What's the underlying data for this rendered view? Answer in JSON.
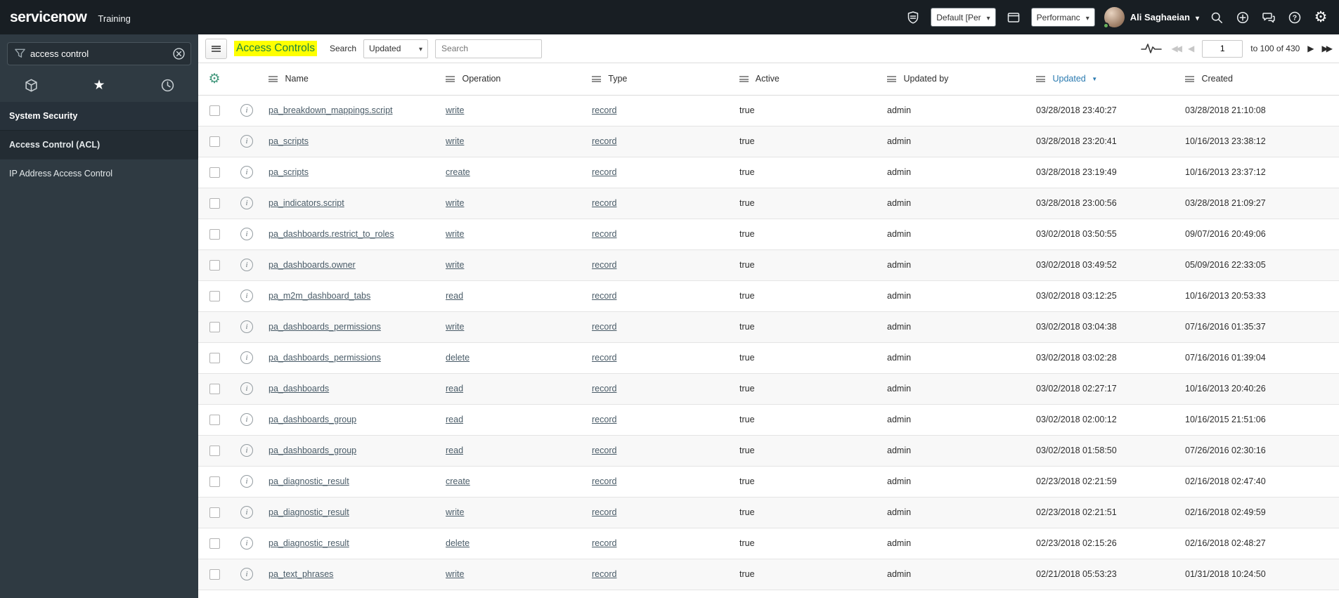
{
  "banner": {
    "logo": "servicenow",
    "instance": "Training",
    "update_set": "Default [Per",
    "application": "Performanc",
    "user": "Ali Saghaeian"
  },
  "sidebar": {
    "filter_value": "access control",
    "section": "System Security",
    "items": [
      {
        "label": "Access Control (ACL)",
        "selected": true
      },
      {
        "label": "IP Address Access Control",
        "selected": false
      }
    ]
  },
  "list": {
    "title": "Access Controls",
    "search_label": "Search",
    "search_field": "Updated",
    "search_placeholder": "Search",
    "pagination": {
      "page": "1",
      "range_text": "to 100 of 430"
    },
    "columns": [
      "Name",
      "Operation",
      "Type",
      "Active",
      "Updated by",
      "Updated",
      "Created"
    ],
    "sorted_column": "Updated",
    "sort_direction": "desc",
    "rows": [
      {
        "name": "pa_breakdown_mappings.script",
        "operation": "write",
        "type": "record",
        "active": "true",
        "updated_by": "admin",
        "updated": "03/28/2018 23:40:27",
        "created": "03/28/2018 21:10:08"
      },
      {
        "name": "pa_scripts",
        "operation": "write",
        "type": "record",
        "active": "true",
        "updated_by": "admin",
        "updated": "03/28/2018 23:20:41",
        "created": "10/16/2013 23:38:12"
      },
      {
        "name": "pa_scripts",
        "operation": "create",
        "type": "record",
        "active": "true",
        "updated_by": "admin",
        "updated": "03/28/2018 23:19:49",
        "created": "10/16/2013 23:37:12"
      },
      {
        "name": "pa_indicators.script",
        "operation": "write",
        "type": "record",
        "active": "true",
        "updated_by": "admin",
        "updated": "03/28/2018 23:00:56",
        "created": "03/28/2018 21:09:27"
      },
      {
        "name": "pa_dashboards.restrict_to_roles",
        "operation": "write",
        "type": "record",
        "active": "true",
        "updated_by": "admin",
        "updated": "03/02/2018 03:50:55",
        "created": "09/07/2016 20:49:06"
      },
      {
        "name": "pa_dashboards.owner",
        "operation": "write",
        "type": "record",
        "active": "true",
        "updated_by": "admin",
        "updated": "03/02/2018 03:49:52",
        "created": "05/09/2016 22:33:05"
      },
      {
        "name": "pa_m2m_dashboard_tabs",
        "operation": "read",
        "type": "record",
        "active": "true",
        "updated_by": "admin",
        "updated": "03/02/2018 03:12:25",
        "created": "10/16/2013 20:53:33"
      },
      {
        "name": "pa_dashboards_permissions",
        "operation": "write",
        "type": "record",
        "active": "true",
        "updated_by": "admin",
        "updated": "03/02/2018 03:04:38",
        "created": "07/16/2016 01:35:37"
      },
      {
        "name": "pa_dashboards_permissions",
        "operation": "delete",
        "type": "record",
        "active": "true",
        "updated_by": "admin",
        "updated": "03/02/2018 03:02:28",
        "created": "07/16/2016 01:39:04"
      },
      {
        "name": "pa_dashboards",
        "operation": "read",
        "type": "record",
        "active": "true",
        "updated_by": "admin",
        "updated": "03/02/2018 02:27:17",
        "created": "10/16/2013 20:40:26"
      },
      {
        "name": "pa_dashboards_group",
        "operation": "read",
        "type": "record",
        "active": "true",
        "updated_by": "admin",
        "updated": "03/02/2018 02:00:12",
        "created": "10/16/2015 21:51:06"
      },
      {
        "name": "pa_dashboards_group",
        "operation": "read",
        "type": "record",
        "active": "true",
        "updated_by": "admin",
        "updated": "03/02/2018 01:58:50",
        "created": "07/26/2016 02:30:16"
      },
      {
        "name": "pa_diagnostic_result",
        "operation": "create",
        "type": "record",
        "active": "true",
        "updated_by": "admin",
        "updated": "02/23/2018 02:21:59",
        "created": "02/16/2018 02:47:40"
      },
      {
        "name": "pa_diagnostic_result",
        "operation": "write",
        "type": "record",
        "active": "true",
        "updated_by": "admin",
        "updated": "02/23/2018 02:21:51",
        "created": "02/16/2018 02:49:59"
      },
      {
        "name": "pa_diagnostic_result",
        "operation": "delete",
        "type": "record",
        "active": "true",
        "updated_by": "admin",
        "updated": "02/23/2018 02:15:26",
        "created": "02/16/2018 02:48:27"
      },
      {
        "name": "pa_text_phrases",
        "operation": "write",
        "type": "record",
        "active": "true",
        "updated_by": "admin",
        "updated": "02/21/2018 05:53:23",
        "created": "01/31/2018 10:24:50"
      }
    ]
  },
  "colors": {
    "banner_bg": "#181e23",
    "sidebar_bg": "#2f3a42",
    "highlight_yellow": "#feff00",
    "title_green": "#1d8240",
    "sorted_blue": "#2a7ab0",
    "link": "#4a5c68",
    "presence_green": "#68b25c",
    "gear_teal": "#43987d"
  }
}
